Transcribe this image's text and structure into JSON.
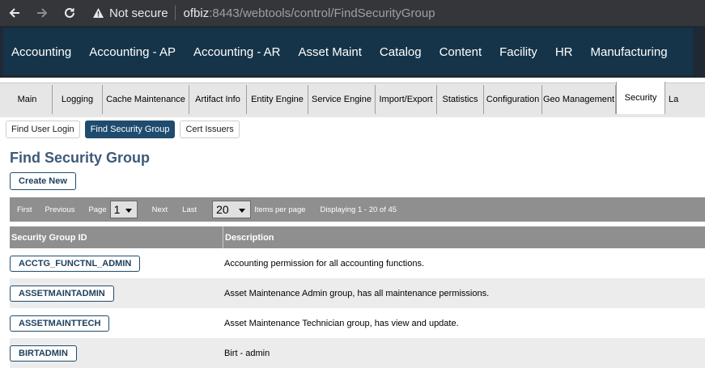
{
  "browser": {
    "security_text": "Not secure",
    "url_host": "ofbiz",
    "url_rest": ":8443/webtools/control/FindSecurityGroup"
  },
  "app_menu": [
    "Accounting",
    "Accounting - AP",
    "Accounting - AR",
    "Asset Maint",
    "Catalog",
    "Content",
    "Facility",
    "HR",
    "Manufacturing"
  ],
  "tabs": [
    "Main",
    "Logging",
    "Cache Maintenance",
    "Artifact Info",
    "Entity Engine",
    "Service Engine",
    "Import/Export",
    "Statistics",
    "Configuration",
    "Geo Management",
    "Security",
    "La"
  ],
  "active_tab": "Security",
  "sub_buttons": [
    "Find User Login",
    "Find Security Group",
    "Cert Issuers"
  ],
  "page": {
    "title": "Find Security Group",
    "create_label": "Create New"
  },
  "pager": {
    "first": "First",
    "previous": "Previous",
    "page_label": "Page",
    "page_value": "1",
    "next": "Next",
    "last": "Last",
    "page_size": "20",
    "items_per_page": "Items per page",
    "displaying": "Displaying 1 - 20 of 45"
  },
  "table": {
    "headers": [
      "Security Group ID",
      "Description"
    ],
    "rows": [
      {
        "id": "ACCTG_FUNCTNL_ADMIN",
        "desc": "Accounting permission for all accounting functions."
      },
      {
        "id": "ASSETMAINTADMIN",
        "desc": "Asset Maintenance Admin group, has all maintenance permissions."
      },
      {
        "id": "ASSETMAINTTECH",
        "desc": "Asset Maintenance Technician group, has view and update."
      },
      {
        "id": "BIRTADMIN",
        "desc": "Birt - admin"
      }
    ]
  },
  "colors": {
    "app_nav_bg": "#153449",
    "accent": "#1f4c6e",
    "pager_bg": "#8f8f8f"
  }
}
